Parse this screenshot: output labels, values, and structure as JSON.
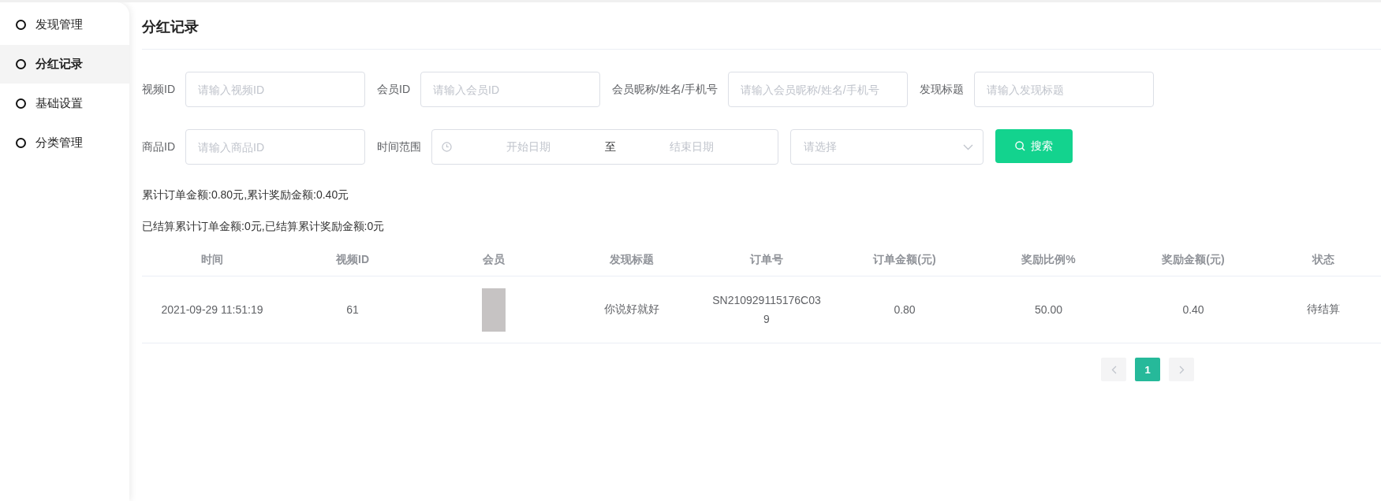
{
  "sidebar": {
    "items": [
      {
        "label": "发现管理",
        "selected": false
      },
      {
        "label": "分红记录",
        "selected": true
      },
      {
        "label": "基础设置",
        "selected": false
      },
      {
        "label": "分类管理",
        "selected": false
      }
    ]
  },
  "page_title": "分红记录",
  "filters": [
    {
      "kind": "input",
      "label": "视频ID",
      "placeholder": "请输入视频ID"
    },
    {
      "kind": "input",
      "label": "会员ID",
      "placeholder": "请输入会员ID"
    },
    {
      "kind": "input",
      "label": "会员昵称/姓名/手机号",
      "placeholder": "请输入会员昵称/姓名/手机号"
    },
    {
      "kind": "input",
      "label": "发现标题",
      "placeholder": "请输入发现标题"
    },
    {
      "kind": "input",
      "label": "商品ID",
      "placeholder": "请输入商品ID"
    },
    {
      "kind": "daterange",
      "label": "时间范围",
      "start_placeholder": "开始日期",
      "separator": "至",
      "end_placeholder": "结束日期"
    },
    {
      "kind": "select",
      "placeholder": "请选择"
    },
    {
      "kind": "button",
      "label": "搜索"
    }
  ],
  "summary": [
    "累计订单金额:0.80元,累计奖励金额:0.40元",
    "已结算累计订单金额:0元,已结算累计奖励金额:0元"
  ],
  "table": {
    "columns": [
      "时间",
      "视频ID",
      "会员",
      "发现标题",
      "订单号",
      "订单金额(元)",
      "奖励比例%",
      "奖励金额(元)",
      "状态"
    ],
    "rows": [
      {
        "time": "2021-09-29 11:51:19",
        "video_id": "61",
        "title": "你说好就好",
        "order_no": "SN210929115176C039",
        "order_amount": "0.80",
        "reward_ratio": "50.00",
        "reward_amount": "0.40",
        "status": "待结算"
      }
    ]
  },
  "pagination": {
    "pages": [
      {
        "label": "1",
        "selected": true
      }
    ]
  }
}
